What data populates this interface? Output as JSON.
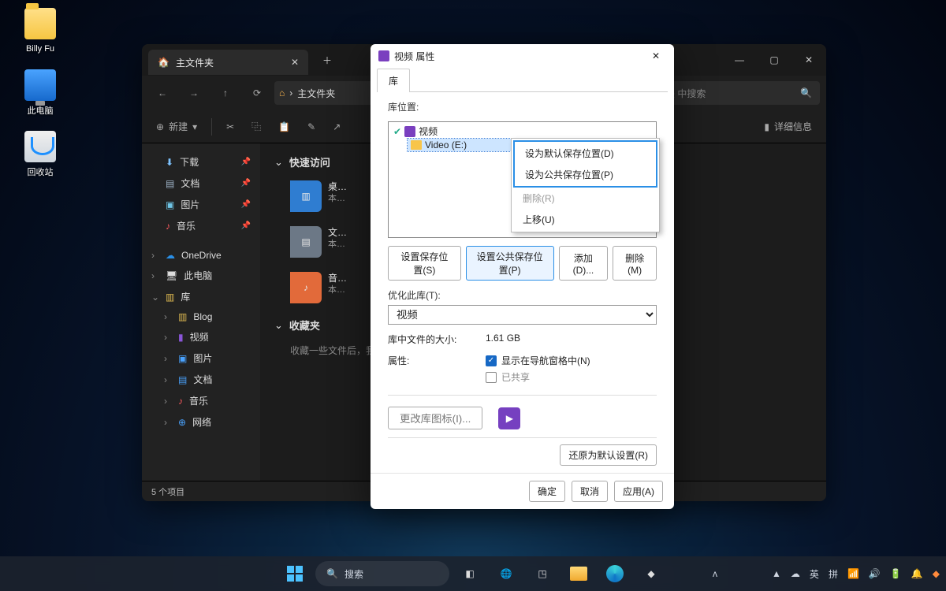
{
  "desktop": {
    "icons": [
      {
        "label": "Billy Fu"
      },
      {
        "label": "此电脑"
      },
      {
        "label": "回收站"
      }
    ]
  },
  "explorer": {
    "tab_title": "主文件夹",
    "breadcrumb": "主文件夹",
    "search_placeholder": "文件夹 中搜索",
    "new_btn": "新建",
    "details_btn": "详细信息",
    "side_quick": [
      {
        "label": "下载",
        "icon": "⬇",
        "pinned": true
      },
      {
        "label": "文档",
        "icon": "▤",
        "pinned": true
      },
      {
        "label": "图片",
        "icon": "▣",
        "pinned": true
      },
      {
        "label": "音乐",
        "icon": "♪",
        "pinned": true
      }
    ],
    "side_main": [
      {
        "label": "OneDrive",
        "icon": "☁",
        "chev": "›"
      },
      {
        "label": "此电脑",
        "icon": "🖥",
        "chev": "›"
      },
      {
        "label": "库",
        "icon": "▥",
        "chev": "⌄"
      }
    ],
    "side_lib": [
      {
        "label": "Blog",
        "icon": "▥"
      },
      {
        "label": "视频",
        "icon": "▮"
      },
      {
        "label": "图片",
        "icon": "▣"
      },
      {
        "label": "文档",
        "icon": "▤"
      },
      {
        "label": "音乐",
        "icon": "♪"
      },
      {
        "label": "网络",
        "icon": "⊕"
      }
    ],
    "quick_access": "快速访问",
    "favorites": "收藏夹",
    "fav_empty": "收藏一些文件后，我…",
    "cards": [
      {
        "title": "桌…",
        "sub": "本…",
        "color": "blue"
      },
      {
        "title": "文…",
        "sub": "本…",
        "color": "grey"
      },
      {
        "title": "音…",
        "sub": "本…",
        "color": "orange"
      }
    ],
    "status": "5 个项目"
  },
  "props": {
    "title": "视频 属性",
    "tab": "库",
    "loc_label": "库位置:",
    "tree": {
      "root": "视频",
      "child": "Video (E:)"
    },
    "ctx": {
      "set_default": "设为默认保存位置(D)",
      "set_public": "设为公共保存位置(P)",
      "remove": "删除(R)",
      "move_up": "上移(U)"
    },
    "btns": {
      "set_save": "设置保存位置(S)",
      "set_pub": "设置公共保存位置(P)",
      "add": "添加(D)...",
      "del": "删除(M)"
    },
    "optimize_label": "优化此库(T):",
    "optimize_value": "视频",
    "size_label": "库中文件的大小:",
    "size_value": "1.61 GB",
    "attr_label": "属性:",
    "show_nav": "显示在导航窗格中(N)",
    "shared": "已共享",
    "change_icon": "更改库图标(I)...",
    "restore": "还原为默认设置(R)",
    "ok": "确定",
    "cancel": "取消",
    "apply": "应用(A)"
  },
  "taskbar": {
    "search": "搜索",
    "tray": {
      "ime1": "英",
      "ime2": "拼"
    }
  }
}
